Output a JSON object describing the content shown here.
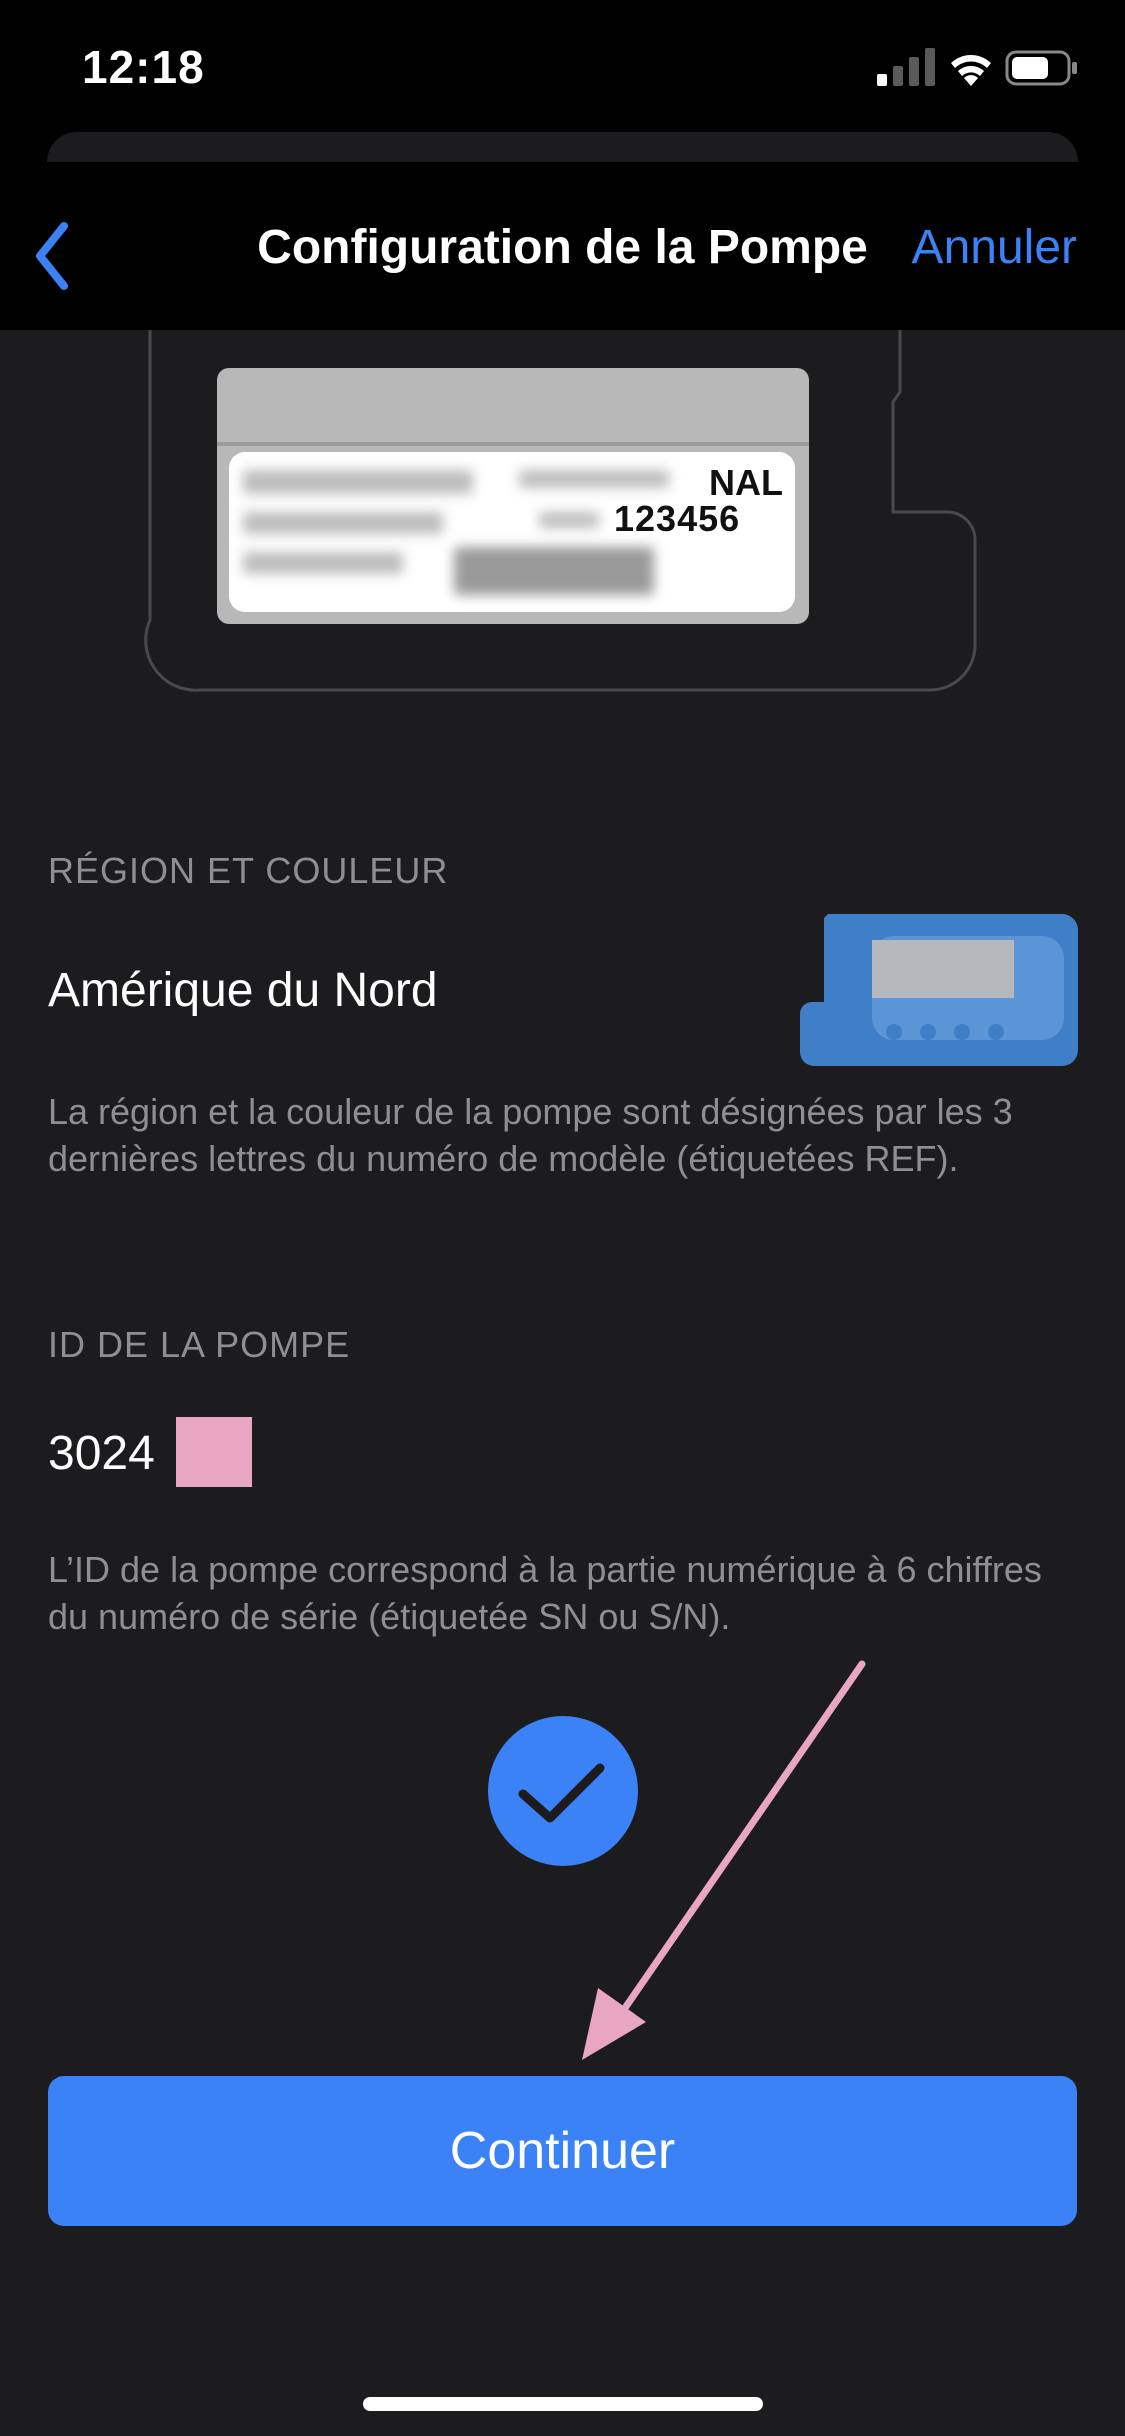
{
  "status_bar": {
    "time": "12:18"
  },
  "nav": {
    "title": "Configuration de la Pompe",
    "cancel_label": "Annuler",
    "accent": "#3b82f6"
  },
  "illustration": {
    "label_ref": "NAL",
    "label_sn": "123456"
  },
  "region": {
    "header": "RÉGION ET COULEUR",
    "value": "Amérique du Nord",
    "footnote": "La région et la couleur de la pompe sont désignées par les 3 dernières lettres du numéro de modèle (étiquetées REF)."
  },
  "pump_id": {
    "header": "ID DE LA POMPE",
    "value": "3024",
    "footnote": "L’ID de la pompe correspond à la partie numérique à 6 chiffres du numéro de série (étiquetée SN ou S/N)."
  },
  "continue_label": "Continuer",
  "colors": {
    "background": "#1c1c1e",
    "accent": "#3b82f6",
    "annotation": "#e8a6c2"
  }
}
